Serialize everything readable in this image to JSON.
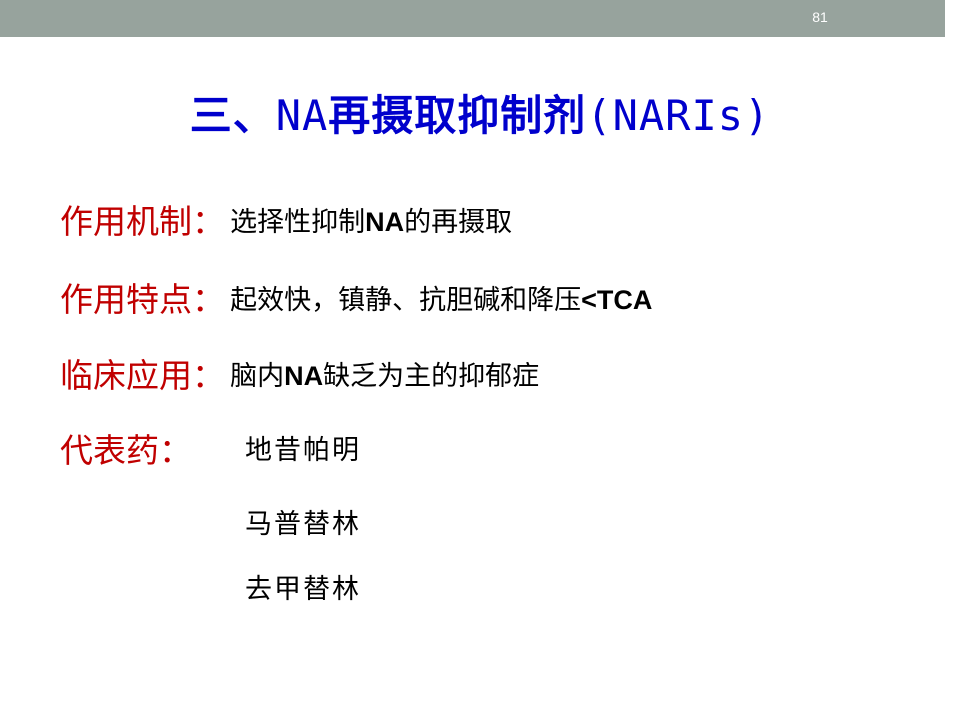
{
  "slide": {
    "number": "81",
    "title": {
      "prefix": "三、",
      "latin1": "NA",
      "middle": "再摄取抑制剂",
      "latin2": "(NARIs)"
    }
  },
  "rows": [
    {
      "label": "作用机制：",
      "text_a": "选择性抑制",
      "bold": "NA",
      "text_b": "的再摄取"
    },
    {
      "label": "作用特点：",
      "text_a": "起效快，镇静、抗胆碱和降压",
      "bold": "<TCA",
      "text_b": ""
    },
    {
      "label": "临床应用：",
      "text_a": "脑内",
      "bold": "NA",
      "text_b": "缺乏为主的抑郁症"
    }
  ],
  "representative": {
    "label": "代表药：",
    "drugs": [
      "地昔帕明",
      "马普替林",
      "去甲替林"
    ]
  }
}
